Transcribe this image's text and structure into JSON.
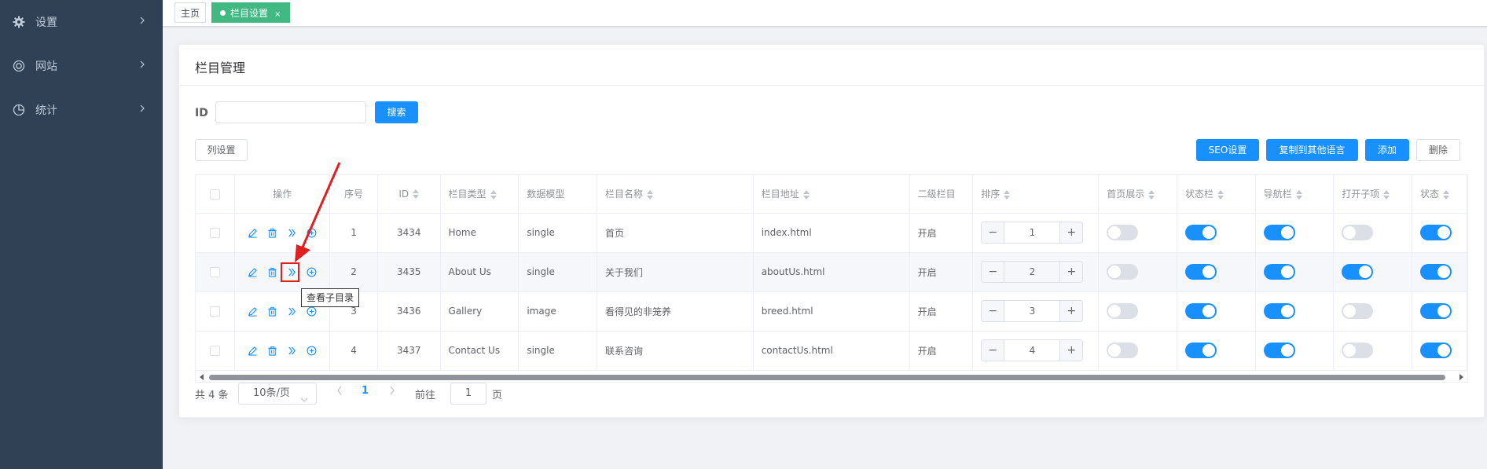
{
  "sidebar": {
    "items": [
      {
        "label": "设置",
        "icon": "gear-icon"
      },
      {
        "label": "网站",
        "icon": "globe-icon"
      },
      {
        "label": "统计",
        "icon": "pie-chart-icon"
      }
    ]
  },
  "tags": {
    "home": "主页",
    "active": "栏目设置",
    "close": "×"
  },
  "page": {
    "title": "栏目管理"
  },
  "search": {
    "label": "ID",
    "value": "",
    "button": "搜索"
  },
  "toolbar": {
    "column_settings": "列设置",
    "seo": "SEO设置",
    "copy": "复制到其他语言",
    "add": "添加",
    "delete": "删除"
  },
  "table": {
    "headers": {
      "ops": "操作",
      "index": "序号",
      "id": "ID",
      "type": "栏目类型",
      "model": "数据模型",
      "name": "栏目名称",
      "url": "栏目地址",
      "secondary": "二级栏目",
      "sort": "排序",
      "home_show": "首页展示",
      "status_bar": "状态栏",
      "nav_bar": "导航栏",
      "open_child": "打开子项",
      "status": "状态"
    },
    "rows": [
      {
        "index": "1",
        "id": "3434",
        "type": "Home",
        "model": "single",
        "name": "首页",
        "url": "index.html",
        "secondary": "开启",
        "sort": "1",
        "home_show": false,
        "status_bar": true,
        "nav_bar": true,
        "open_child": false,
        "status": true
      },
      {
        "index": "2",
        "id": "3435",
        "type": "About Us",
        "model": "single",
        "name": "关于我们",
        "url": "aboutUs.html",
        "secondary": "开启",
        "sort": "2",
        "home_show": false,
        "status_bar": true,
        "nav_bar": true,
        "open_child": true,
        "status": true
      },
      {
        "index": "3",
        "id": "3436",
        "type": "Gallery",
        "model": "image",
        "name": "看得见的非笼养",
        "url": "breed.html",
        "secondary": "开启",
        "sort": "3",
        "home_show": false,
        "status_bar": true,
        "nav_bar": true,
        "open_child": false,
        "status": true
      },
      {
        "index": "4",
        "id": "3437",
        "type": "Contact Us",
        "model": "single",
        "name": "联系咨询",
        "url": "contactUs.html",
        "secondary": "开启",
        "sort": "4",
        "home_show": false,
        "status_bar": true,
        "nav_bar": true,
        "open_child": false,
        "status": true
      }
    ]
  },
  "pagination": {
    "total": "共 4 条",
    "page_size": "10条/页",
    "current": "1",
    "goto_label": "前往",
    "goto_value": "1",
    "goto_unit": "页"
  },
  "tooltip": {
    "text": "查看子目录"
  },
  "colors": {
    "sidebar_bg": "#304156",
    "primary": "#1890ff",
    "active_tag": "#42b983",
    "highlight": "#e02020"
  }
}
